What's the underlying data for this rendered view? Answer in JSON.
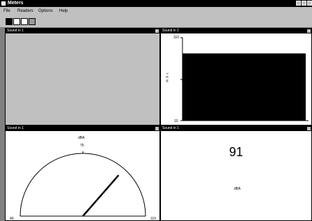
{
  "window": {
    "title": "Meters"
  },
  "menu": [
    "File",
    "Readers",
    "Options",
    "Help"
  ],
  "panes": {
    "top_left": {
      "title": "Sound in 1"
    },
    "top_right": {
      "title": "Sound in 1",
      "ymax": "110",
      "ymin": "10",
      "ylabel": "> u: w",
      "value": 91
    },
    "bottom_left": {
      "title": "Sound in 1",
      "unit": "dBA",
      "mid": "75",
      "min": "40",
      "max": "110",
      "value": 91
    },
    "bottom_right": {
      "title": "Sound in 1",
      "value": "91",
      "unit": "dBA"
    }
  }
}
